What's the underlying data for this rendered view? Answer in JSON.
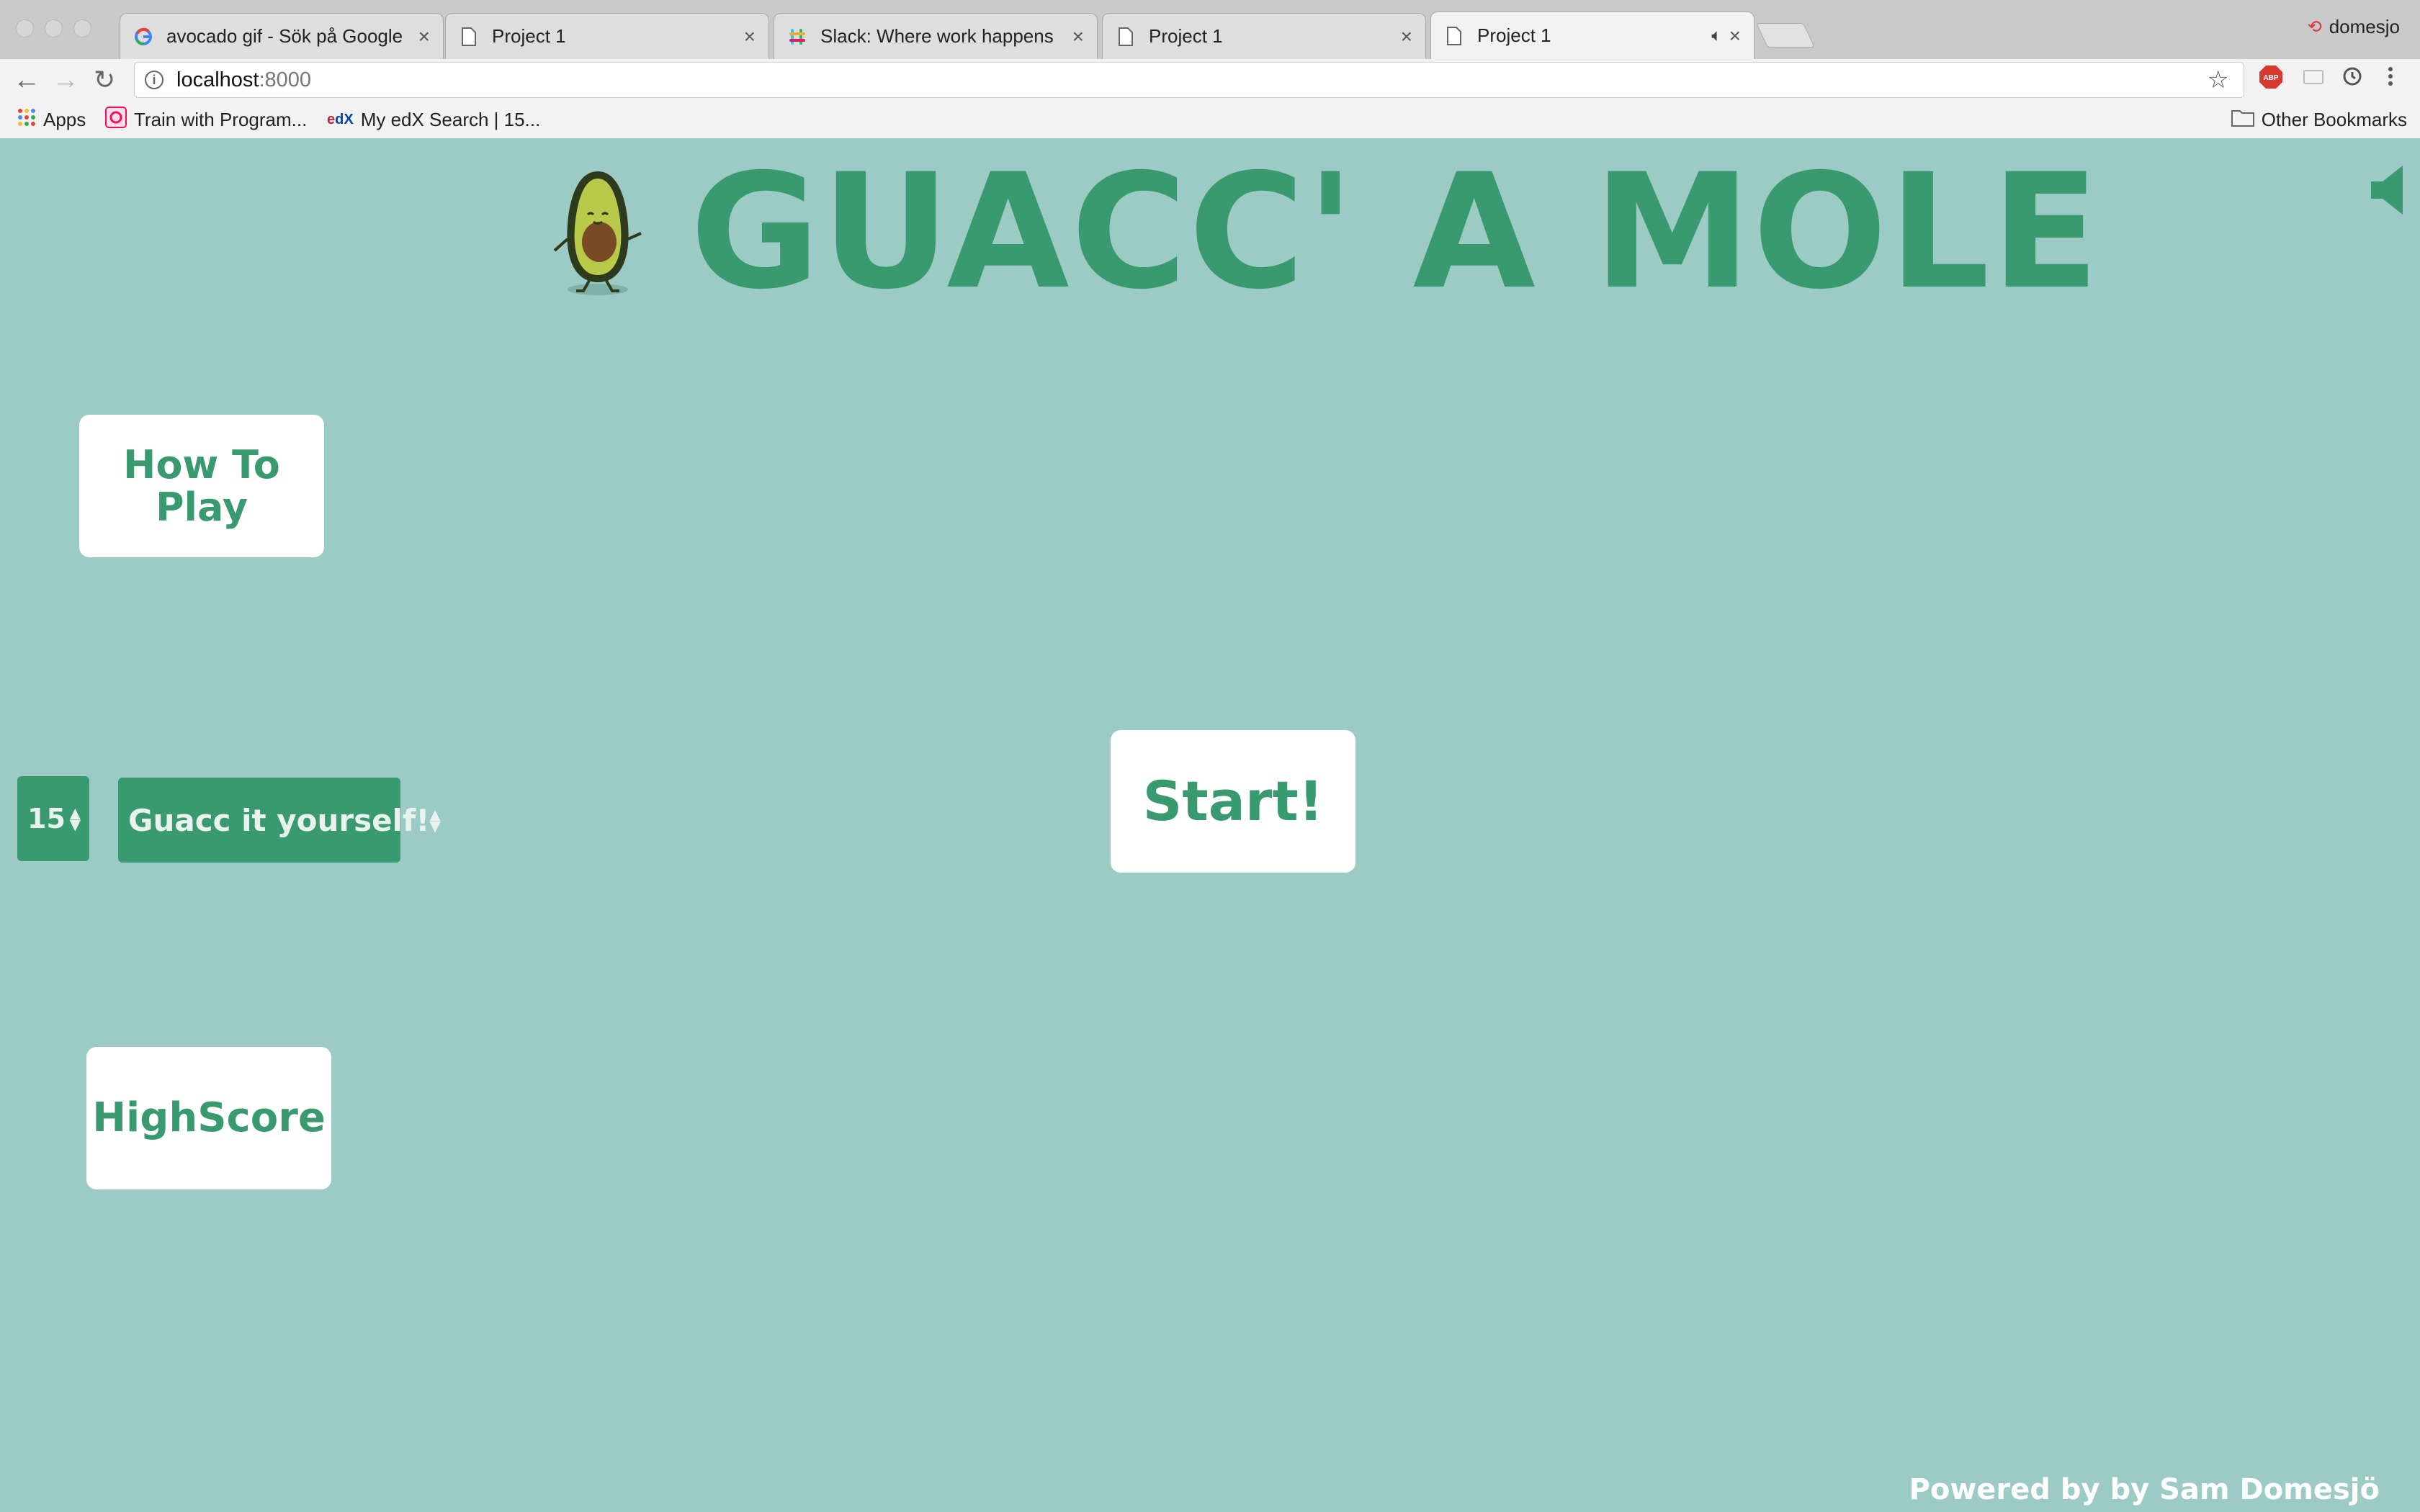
{
  "browser": {
    "tabs": [
      {
        "title": "avocado gif - Sök på Google",
        "icon": "google-icon"
      },
      {
        "title": "Project 1",
        "icon": "page-icon"
      },
      {
        "title": "Slack: Where work happens",
        "icon": "slack-icon"
      },
      {
        "title": "Project 1",
        "icon": "page-icon"
      },
      {
        "title": "Project 1",
        "icon": "page-icon",
        "active": true,
        "playing_audio": true
      }
    ],
    "profile_name": "domesjo",
    "url_host": "localhost",
    "url_port": ":8000",
    "bookmarks": {
      "apps": "Apps",
      "item1": "Train with Program...",
      "item2": "My edX Search | 15...",
      "other": "Other Bookmarks"
    },
    "extensions": [
      "adblock-icon",
      "cast-icon",
      "sync-icon",
      "menu-icon"
    ]
  },
  "game": {
    "title": "GUACC' A MOLE",
    "how_to_play": "How To Play",
    "start": "Start!",
    "high_score": "HighScore",
    "time_select": {
      "value": "15"
    },
    "mode_select": {
      "value": "Guacc it yourself!"
    },
    "footer": "Powered by by Sam Domesjö"
  },
  "colors": {
    "background": "#9bcbc4",
    "accent": "#3a9a6f",
    "card": "#ffffff"
  }
}
